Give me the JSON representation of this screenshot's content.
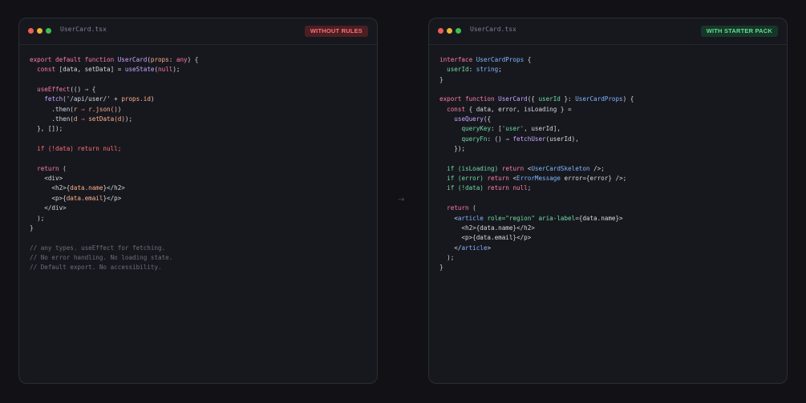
{
  "left": {
    "filename": "UserCard.tsx",
    "badge": "WITHOUT RULES",
    "lines": [
      "export default function UserCard(props: any) {",
      "  const [data, setData] = useState(null);",
      "",
      "  useEffect(() ⇒ {",
      "    fetch('/api/user/' + props.id)",
      "      .then(r ⇒ r.json())",
      "      .then(d ⇒ setData(d));",
      "  }, []);",
      "",
      "  if (!data) return null;",
      "",
      "  return (",
      "    <div>",
      "      <h2>{data.name}</h2>",
      "      <p>{data.email}</p>",
      "    </div>",
      "  );",
      "}",
      "",
      "// any types. useEffect for fetching.",
      "// No error handling. No loading state.",
      "// Default export. No accessibility."
    ]
  },
  "right": {
    "filename": "UserCard.tsx",
    "badge": "WITH STARTER PACK",
    "lines": [
      "interface UserCardProps {",
      "  userId: string;",
      "}",
      "",
      "export function UserCard({ userId }: UserCardProps) {",
      "  const { data, error, isLoading } =",
      "    useQuery({",
      "      queryKey: ['user', userId],",
      "      queryFn: () ⇒ fetchUser(userId),",
      "    });",
      "",
      "  if (isLoading) return <UserCardSkeleton />;",
      "  if (error) return <ErrorMessage error={error} />;",
      "  if (!data) return null;",
      "",
      "  return (",
      "    <article role=\"region\" aria-label={data.name}>",
      "      <h2>{data.name}</h2>",
      "      <p>{data.email}</p>",
      "    </article>",
      "  );",
      "}"
    ]
  },
  "arrow": "→",
  "colors": {
    "background": "#111116",
    "panel": "#17181e",
    "badge_bad": "#ff6f74",
    "badge_good": "#5fe08f"
  }
}
